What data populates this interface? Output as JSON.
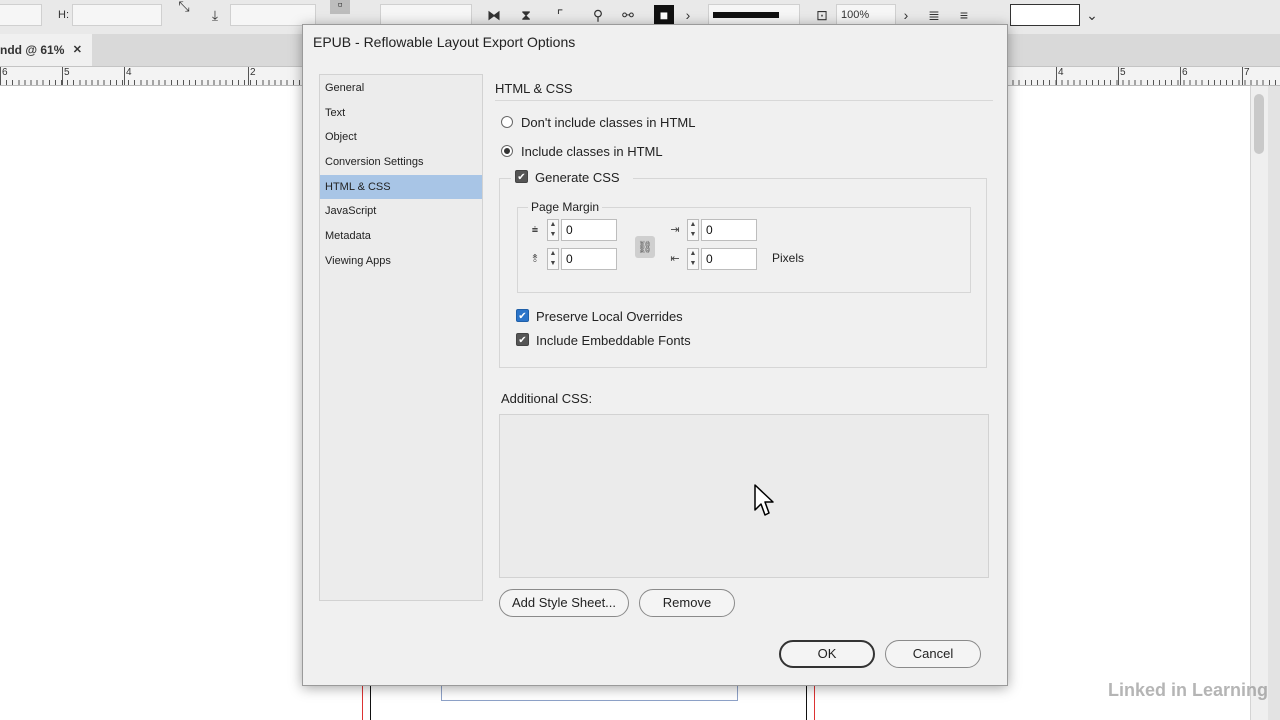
{
  "toolbar": {
    "h_label": "H:",
    "zoom_value": "100%"
  },
  "document": {
    "tab_label": "ndd @ 61%",
    "tab_close": "✕"
  },
  "ruler": {
    "left_ticks": [
      "6",
      "5",
      "4",
      "2"
    ],
    "right_ticks": [
      "4",
      "5",
      "6",
      "7"
    ]
  },
  "dialog": {
    "title": "EPUB - Reflowable Layout Export Options",
    "nav_items": [
      {
        "label": "General"
      },
      {
        "label": "Text"
      },
      {
        "label": "Object"
      },
      {
        "label": "Conversion Settings"
      },
      {
        "label": "HTML & CSS"
      },
      {
        "label": "JavaScript"
      },
      {
        "label": "Metadata"
      },
      {
        "label": "Viewing Apps"
      }
    ],
    "selected_nav": "HTML & CSS",
    "section_title": "HTML & CSS",
    "radio_no_classes": "Don't include classes in HTML",
    "radio_include_classes": "Include classes in HTML",
    "radio_selected": "Include classes in HTML",
    "generate_css_label": "Generate CSS",
    "generate_css_checked": true,
    "page_margin": {
      "legend": "Page Margin",
      "top": "0",
      "bottom": "0",
      "left": "0",
      "right": "0",
      "units": "Pixels"
    },
    "preserve_overrides_label": "Preserve Local Overrides",
    "preserve_overrides_checked": true,
    "embed_fonts_label": "Include Embeddable Fonts",
    "embed_fonts_checked": true,
    "additional_css_label": "Additional CSS:",
    "add_style_sheet_button": "Add Style Sheet...",
    "remove_button": "Remove",
    "ok_button": "OK",
    "cancel_button": "Cancel"
  },
  "branding": {
    "watermark": "Linked in Learning"
  },
  "colors": {
    "selection": "#a8c5e6",
    "checkbox_blue": "#2b74c9"
  }
}
